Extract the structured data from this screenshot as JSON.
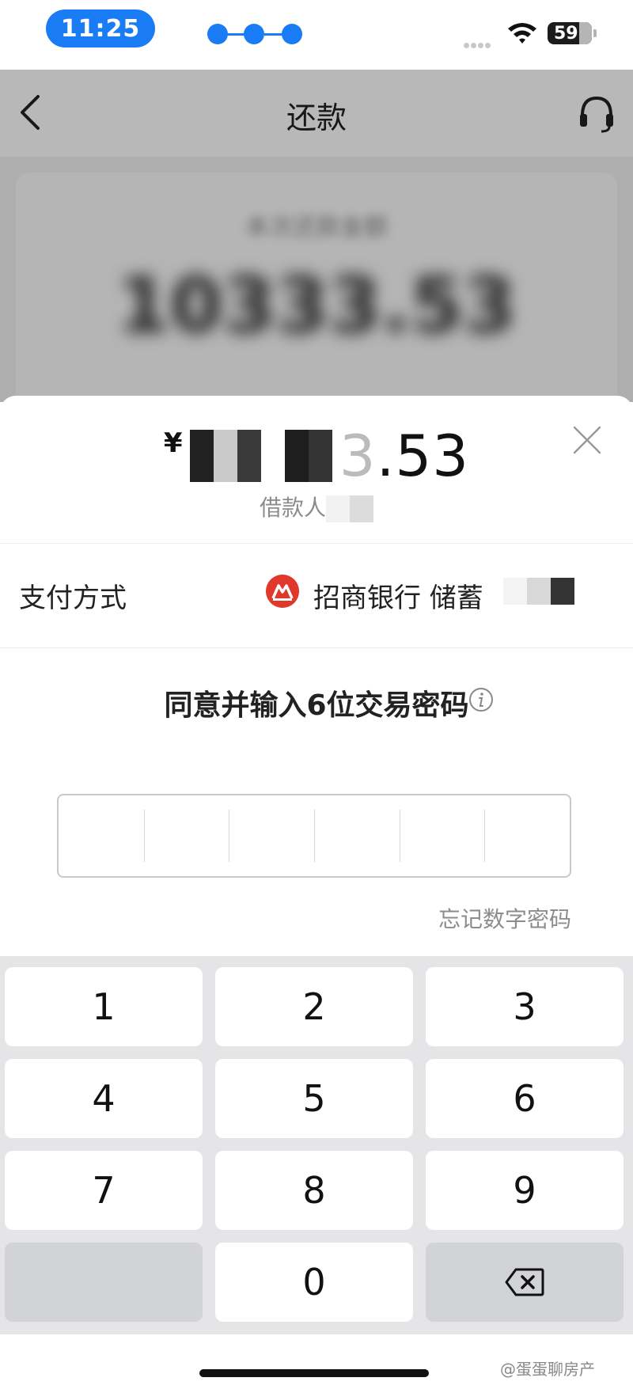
{
  "status_bar": {
    "time": "11:25",
    "battery": "59",
    "accent": "#1a7cf5"
  },
  "nav": {
    "title": "还款",
    "back_icon": "chevron-left-icon",
    "service_icon": "headset-icon"
  },
  "background_card": {
    "label": "本次还款金额",
    "amount": "10333.53"
  },
  "payment_sheet": {
    "currency": "¥",
    "amount_visible": ".53",
    "amount_visible_digit": "3",
    "borrower_label": "借款人",
    "payment_method_label": "支付方式",
    "bank_name": "招商银行 储蓄",
    "bank_color": "#e0392b",
    "prompt": "同意并输入6位交易密码",
    "forgot_link": "忘记数字密码",
    "password_length": 6
  },
  "keypad": {
    "keys": [
      "1",
      "2",
      "3",
      "4",
      "5",
      "6",
      "7",
      "8",
      "9",
      "",
      "0",
      "⌫"
    ]
  },
  "watermark": "@蛋蛋聊房产"
}
